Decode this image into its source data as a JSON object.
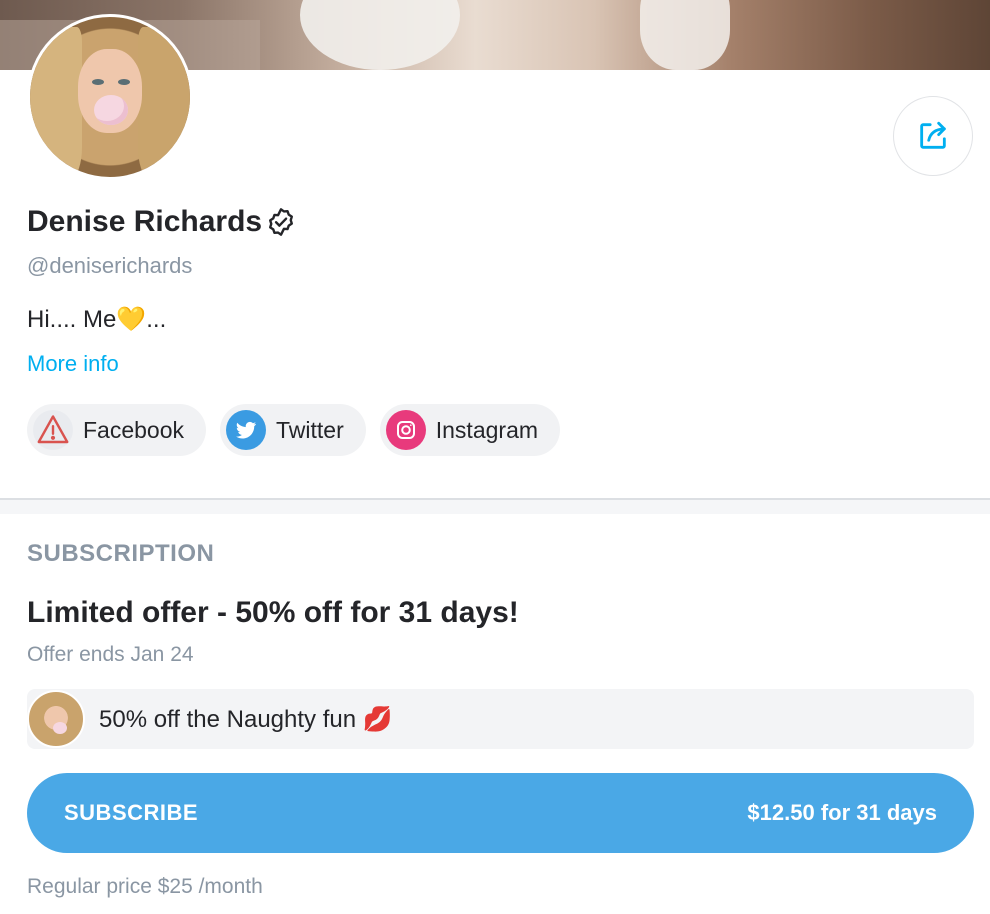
{
  "profile": {
    "name": "Denise Richards",
    "handle": "@deniserichards",
    "bio": "Hi.... Me💛...",
    "more_info": "More info"
  },
  "socials": [
    {
      "label": "Facebook",
      "icon": "warning-icon"
    },
    {
      "label": "Twitter",
      "icon": "twitter-icon"
    },
    {
      "label": "Instagram",
      "icon": "instagram-icon"
    }
  ],
  "subscription": {
    "heading": "SUBSCRIPTION",
    "offer_title": "Limited offer - 50% off for 31 days!",
    "offer_ends": "Offer ends Jan 24",
    "promo_message": "50% off the Naughty fun 💋",
    "subscribe_label": "SUBSCRIBE",
    "subscribe_price": "$12.50 for 31 days",
    "regular_price": "Regular price $25 /month"
  },
  "colors": {
    "accent": "#00aff0",
    "subscribe_bg": "#4aa8e6",
    "muted": "#8a96a3",
    "twitter": "#3a9be2",
    "instagram": "#e83a7c"
  }
}
